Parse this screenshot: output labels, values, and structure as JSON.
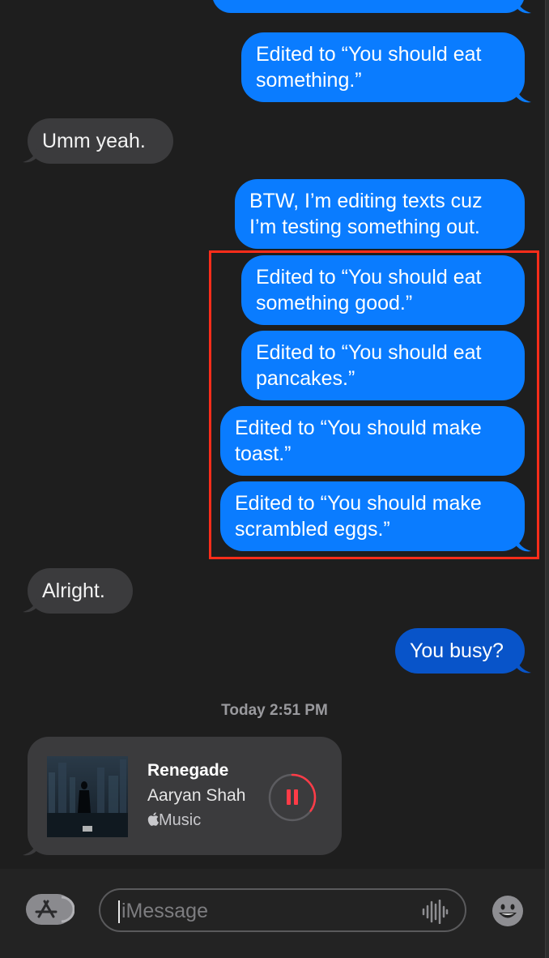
{
  "messages": [
    {
      "id": "m1",
      "label": "Edited to “You should eat\nsomething.”"
    },
    {
      "id": "m2",
      "label": "Umm yeah."
    },
    {
      "id": "m3",
      "label": "BTW, I’m editing texts cuz\nI’m testing something out."
    },
    {
      "id": "m4",
      "label": "Edited to “You should eat\nsomething good.”"
    },
    {
      "id": "m5",
      "label": "Edited to “You should eat\npancakes.”"
    },
    {
      "id": "m6",
      "label": "Edited to “You should make\ntoast.”"
    },
    {
      "id": "m7",
      "label": "Edited to “You should make\nscrambled eggs.”"
    },
    {
      "id": "m8",
      "label": "Alright."
    },
    {
      "id": "m9",
      "label": "You busy?"
    }
  ],
  "timestamp": "Today 2:51 PM",
  "music": {
    "title": "Renegade",
    "artist": "Aaryan Shah",
    "source": "Music",
    "progress": 0.35
  },
  "input": {
    "placeholder": "iMessage"
  },
  "colors": {
    "outgoing": "#0a7cff",
    "outgoing_selected": "#0854c9",
    "incoming": "#3b3b3d",
    "highlight": "#ff2d1a",
    "pause": "#ff3b47"
  },
  "icons": {
    "appstore": "appstore-icon",
    "waveform": "waveform-icon",
    "emoji": "emoji-icon",
    "apple": "apple-logo-icon",
    "pause": "pause-icon"
  }
}
